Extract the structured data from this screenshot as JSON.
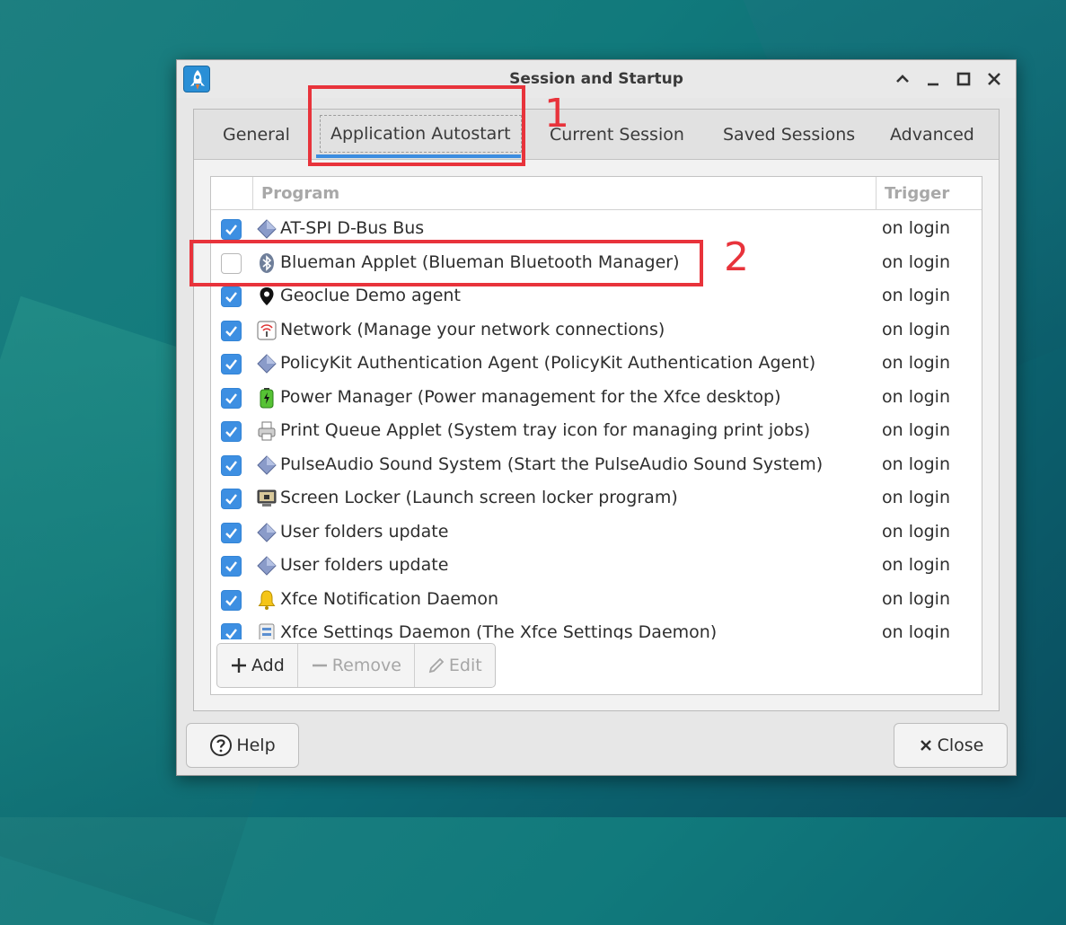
{
  "window": {
    "title": "Session and Startup"
  },
  "tabs": [
    {
      "label": "General"
    },
    {
      "label": "Application Autostart"
    },
    {
      "label": "Current Session"
    },
    {
      "label": "Saved Sessions"
    },
    {
      "label": "Advanced"
    }
  ],
  "list": {
    "header_program": "Program",
    "header_trigger": "Trigger",
    "rows": [
      {
        "checked": true,
        "icon": "diamond-icon",
        "label": "AT-SPI D-Bus Bus",
        "trigger": "on login"
      },
      {
        "checked": false,
        "icon": "bluetooth-icon",
        "label": "Blueman Applet (Blueman Bluetooth Manager)",
        "trigger": "on login"
      },
      {
        "checked": true,
        "icon": "location-pin-icon",
        "label": "Geoclue Demo agent",
        "trigger": "on login"
      },
      {
        "checked": true,
        "icon": "network-icon",
        "label": "Network (Manage your network connections)",
        "trigger": "on login"
      },
      {
        "checked": true,
        "icon": "diamond-icon",
        "label": "PolicyKit Authentication Agent (PolicyKit Authentication Agent)",
        "trigger": "on login"
      },
      {
        "checked": true,
        "icon": "battery-icon",
        "label": "Power Manager (Power management for the Xfce desktop)",
        "trigger": "on login"
      },
      {
        "checked": true,
        "icon": "printer-icon",
        "label": "Print Queue Applet (System tray icon for managing print jobs)",
        "trigger": "on login"
      },
      {
        "checked": true,
        "icon": "diamond-icon",
        "label": "PulseAudio Sound System (Start the PulseAudio Sound System)",
        "trigger": "on login"
      },
      {
        "checked": true,
        "icon": "monitor-lock-icon",
        "label": "Screen Locker (Launch screen locker program)",
        "trigger": "on login"
      },
      {
        "checked": true,
        "icon": "diamond-icon",
        "label": "User folders update",
        "trigger": "on login"
      },
      {
        "checked": true,
        "icon": "diamond-icon",
        "label": "User folders update",
        "trigger": "on login"
      },
      {
        "checked": true,
        "icon": "bell-icon",
        "label": "Xfce Notification Daemon",
        "trigger": "on login"
      },
      {
        "checked": true,
        "icon": "settings-icon",
        "label": "Xfce Settings Daemon (The Xfce Settings Daemon)",
        "trigger": "on login"
      }
    ]
  },
  "toolbar": {
    "add_label": "Add",
    "remove_label": "Remove",
    "edit_label": "Edit"
  },
  "buttons": {
    "help_label": "Help",
    "close_label": "Close"
  },
  "annotations": {
    "label_1": "1",
    "label_2": "2",
    "color": "#e8333b"
  },
  "colors": {
    "accent": "#3d8fe2"
  }
}
